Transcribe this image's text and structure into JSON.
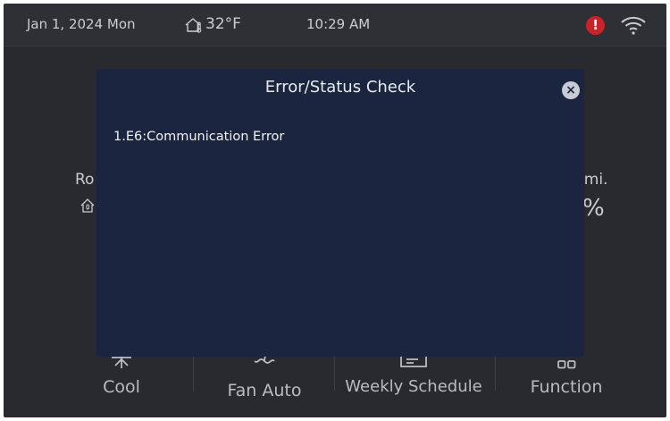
{
  "statusbar": {
    "date": "Jan 1, 2024 Mon",
    "outdoor_temp": "32°F",
    "time": "10:29 AM",
    "alert_symbol": "!",
    "alert_icon": "alert-icon",
    "wifi_icon": "wifi-icon",
    "outdoor_icon": "house-thermometer-icon"
  },
  "background": {
    "left_label_partial": "Ro",
    "right_label_partial": "umi.",
    "right_value_partial": "%"
  },
  "bottom_bar": {
    "items": [
      {
        "label": "Cool",
        "icon": "snowflake-icon"
      },
      {
        "label": "Fan Auto",
        "icon": "fan-icon"
      },
      {
        "label": "Weekly Schedule",
        "icon": "schedule-icon"
      },
      {
        "label": "Function",
        "icon": "grid-icon"
      }
    ]
  },
  "modal": {
    "title": "Error/Status Check",
    "close_symbol": "×",
    "items": [
      "1.E6:Communication Error"
    ]
  },
  "colors": {
    "background": "#282a2f",
    "modal": "#1c2540",
    "alert": "#c8242a"
  }
}
